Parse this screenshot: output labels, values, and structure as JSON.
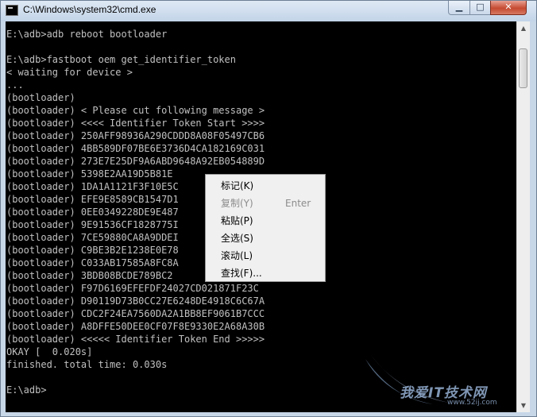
{
  "window": {
    "title": "C:\\Windows\\system32\\cmd.exe",
    "controls": {
      "minimize": "▁",
      "maximize": "□",
      "close": "✕"
    }
  },
  "console": {
    "lines": [
      "E:\\adb>adb reboot bootloader",
      "",
      "E:\\adb>fastboot oem get_identifier_token",
      "< waiting for device >",
      "...",
      "(bootloader)",
      "(bootloader) < Please cut following message >",
      "(bootloader) <<<< Identifier Token Start >>>>",
      "(bootloader) 250AFF98936A290CDDD8A08F05497CB6",
      "(bootloader) 4BB589DF07BE6E3736D4CA182169C031",
      "(bootloader) 273E7E25DF9A6ABD9648A92EB054889D",
      "(bootloader) 5398E2AA19D5B81E",
      "(bootloader) 1DA1A1121F3F10E5C",
      "(bootloader) EFE9E8589CB1547D1",
      "(bootloader) 0EE0349228DE9E487",
      "(bootloader) 9E91536CF1828775I",
      "(bootloader) 7CE59880CA8A9DDEI",
      "(bootloader) C9BE3B2E1238E0E78",
      "(bootloader) C033AB17585A8FC8A",
      "(bootloader) 3BDB08BCDE789BC2",
      "(bootloader) F97D6169EFEFDF24027CD021871F23C",
      "(bootloader) D90119D73B0CC27E6248DE4918C6C67A",
      "(bootloader) CDC2F24EA7560DA2A1BB8EF9061B7CCC",
      "(bootloader) A8DFFE50DEE0CF07F8E9330E2A68A30B",
      "(bootloader) <<<<< Identifier Token End >>>>>",
      "OKAY [  0.020s]",
      "finished. total time: 0.030s",
      "",
      "E:\\adb>"
    ]
  },
  "context_menu": {
    "items": [
      {
        "label": "标记(K)",
        "shortcut": "",
        "enabled": true
      },
      {
        "label": "复制(Y)",
        "shortcut": "Enter",
        "enabled": false
      },
      {
        "label": "粘贴(P)",
        "shortcut": "",
        "enabled": true
      },
      {
        "label": "全选(S)",
        "shortcut": "",
        "enabled": true
      },
      {
        "label": "滚动(L)",
        "shortcut": "",
        "enabled": true
      },
      {
        "label": "查找(F)...",
        "shortcut": "",
        "enabled": true
      }
    ]
  },
  "scrollbar": {
    "up_arrow": "▲",
    "down_arrow": "▼"
  },
  "watermark": {
    "text": "我爱IT技术网",
    "url": "www.52ij.com"
  }
}
